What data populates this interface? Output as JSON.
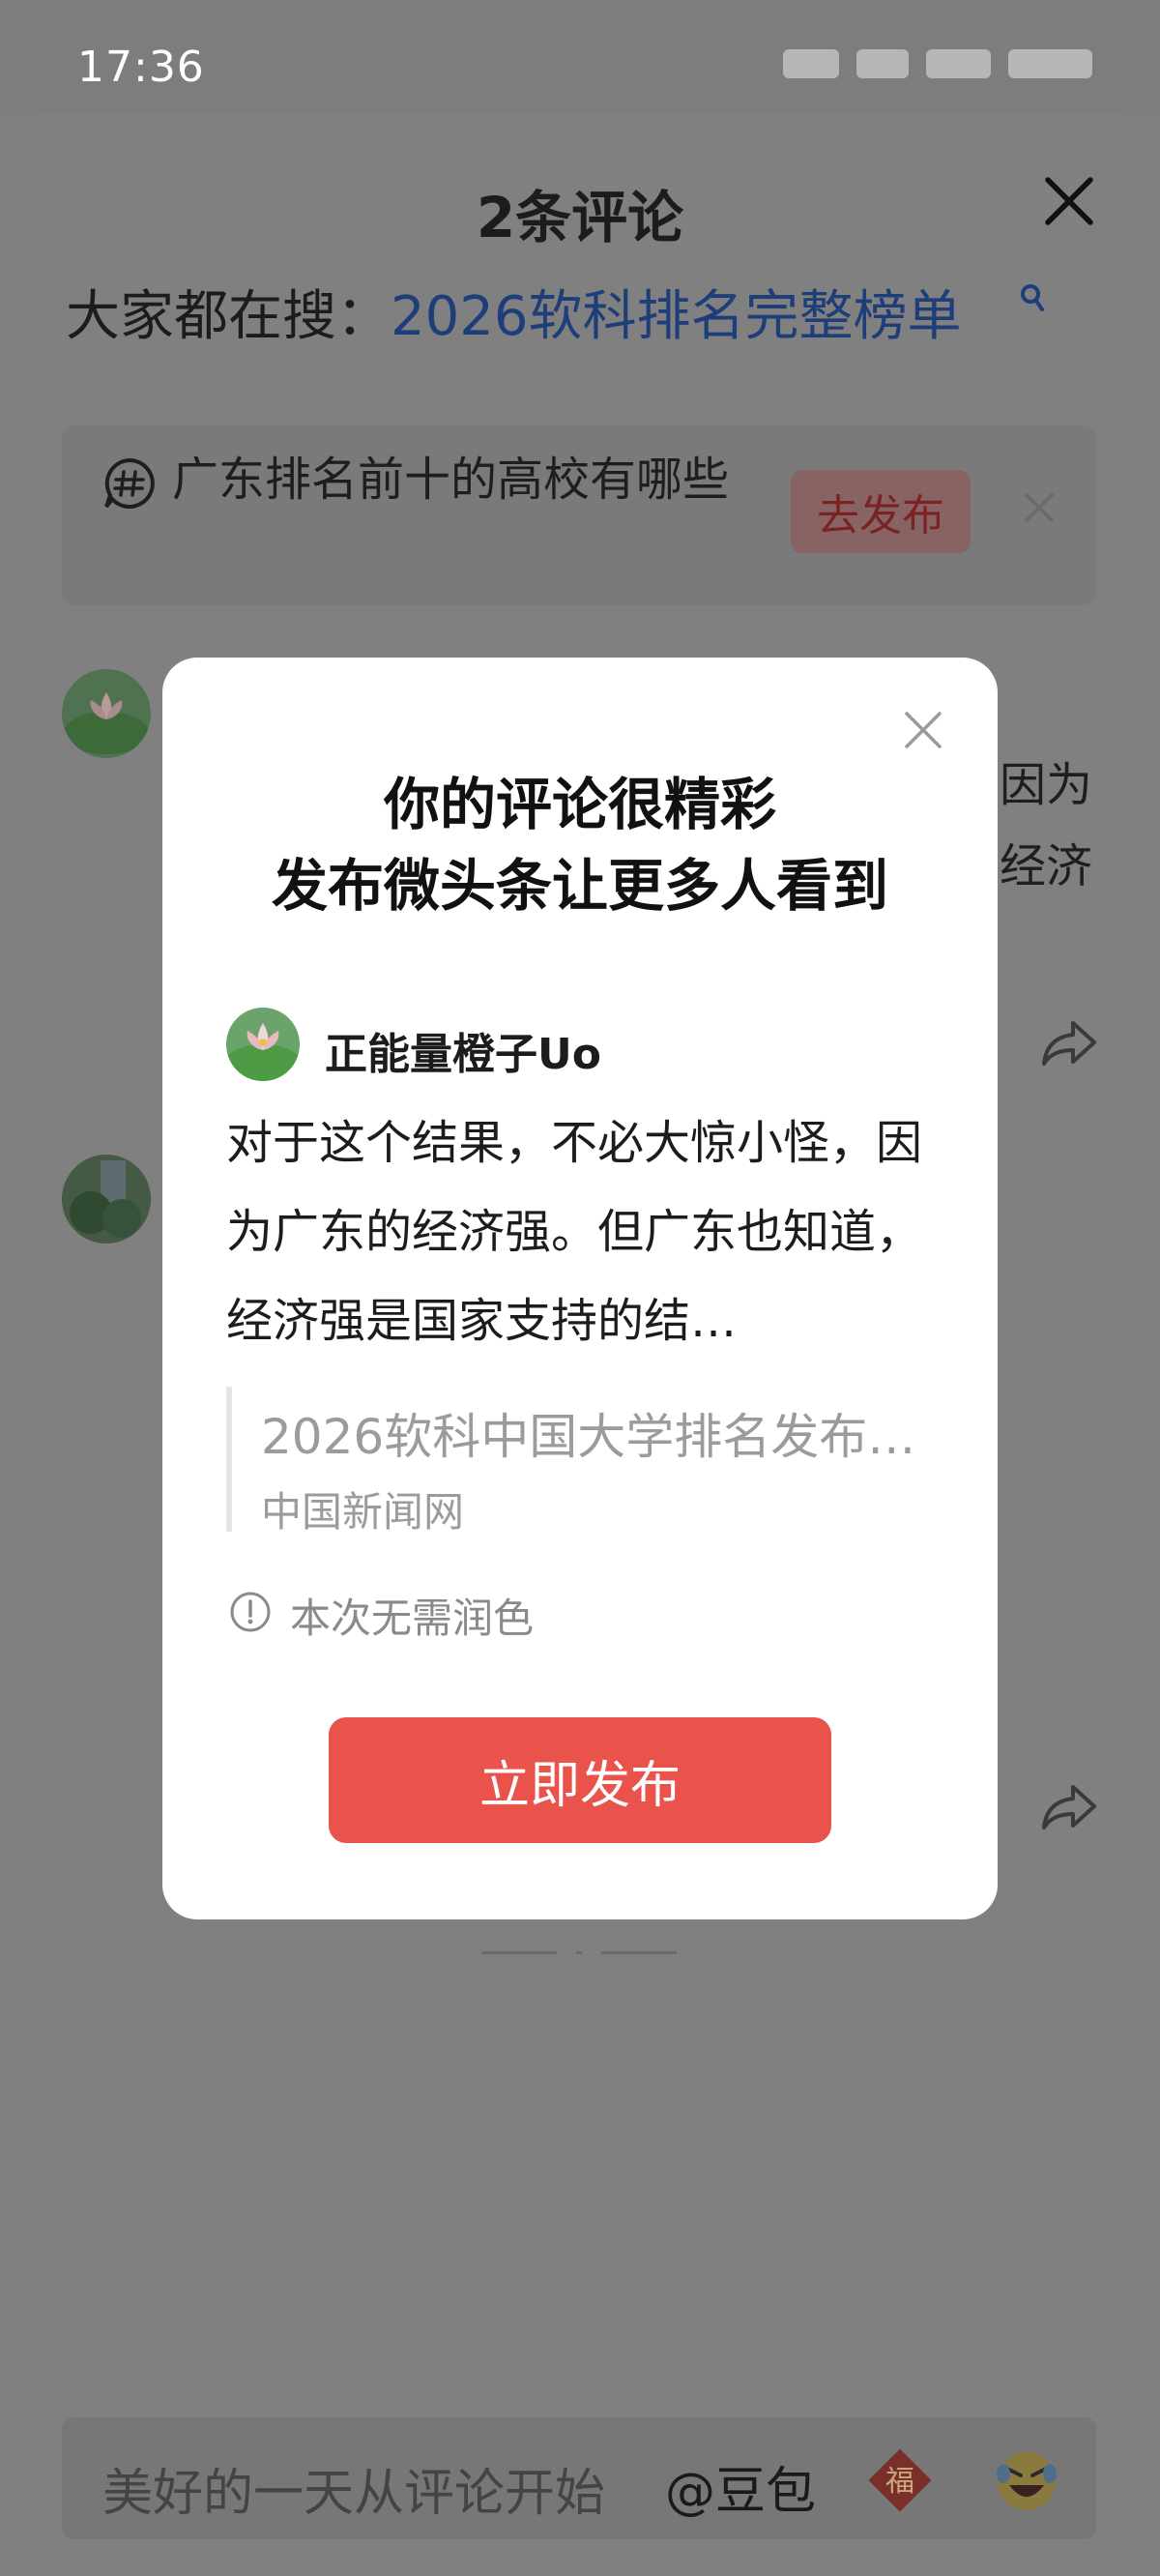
{
  "status_bar": {
    "time": "17:36"
  },
  "comment_sheet": {
    "title": "2条评论",
    "search_hint_prefix": "大家都在搜：",
    "search_hint_keyword": "2026软科排名完整榜单",
    "topic_prompt": {
      "text": "广东排名前十的高校有哪些",
      "button": "去发布"
    },
    "comment_fragments": {
      "line1_tail": "因为",
      "line2_tail": "经济"
    },
    "input_placeholder": "美好的一天从评论开始",
    "at_doubao": "@豆包",
    "fu_icon_char": "福"
  },
  "modal": {
    "title_line1": "你的评论很精彩",
    "title_line2": "发布微头条让更多人看到",
    "username": "正能量橙子Uo",
    "comment_text": "对于这个结果，不必大惊小怪，因为广东的经济强。但广东也知道，经济强是国家支持的结…",
    "quoted_article_title": "2026软科中国大学排名发布…",
    "quoted_article_source": "中国新闻网",
    "note": "本次无需润色",
    "cta": "立即发布"
  },
  "colors": {
    "overlay_gray": "#7f7f7f",
    "link_blue_dimmed": "#1e3e7a",
    "cta_red": "#e9534b",
    "muted_gray": "#9b9b9b"
  },
  "icons": [
    "close-icon",
    "search-icon",
    "hashtag-comment-icon",
    "share-icon",
    "info-icon",
    "fu-icon",
    "laughing-emoji-icon"
  ]
}
